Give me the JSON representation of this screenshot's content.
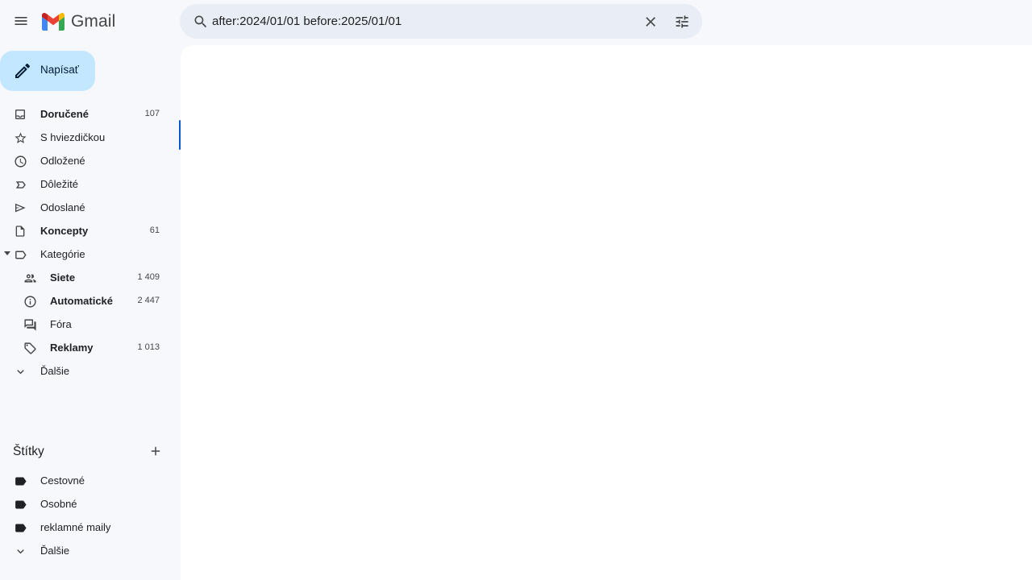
{
  "app": {
    "title": "Gmail"
  },
  "search": {
    "value": "after:2024/01/01 before:2025/01/01"
  },
  "compose": {
    "label": "Napísať"
  },
  "nav": {
    "items": [
      {
        "key": "inbox",
        "label": "Doručené",
        "count": "107",
        "bold": true,
        "icon": "inbox-icon"
      },
      {
        "key": "starred",
        "label": "S hviezdičkou",
        "count": "",
        "bold": false,
        "icon": "star-icon"
      },
      {
        "key": "snoozed",
        "label": "Odložené",
        "count": "",
        "bold": false,
        "icon": "clock-icon"
      },
      {
        "key": "important",
        "label": "Dôležité",
        "count": "",
        "bold": false,
        "icon": "important-icon"
      },
      {
        "key": "sent",
        "label": "Odoslané",
        "count": "",
        "bold": false,
        "icon": "send-icon"
      },
      {
        "key": "drafts",
        "label": "Koncepty",
        "count": "61",
        "bold": true,
        "icon": "draft-icon"
      },
      {
        "key": "categories",
        "label": "Kategórie",
        "count": "",
        "bold": false,
        "icon": "label-outline-icon"
      },
      {
        "key": "social",
        "label": "Siete",
        "count": "1 409",
        "bold": true,
        "icon": "people-icon"
      },
      {
        "key": "updates",
        "label": "Automatické",
        "count": "2 447",
        "bold": true,
        "icon": "info-icon"
      },
      {
        "key": "forums",
        "label": "Fóra",
        "count": "",
        "bold": false,
        "icon": "forum-icon"
      },
      {
        "key": "promotions",
        "label": "Reklamy",
        "count": "1 013",
        "bold": true,
        "icon": "tag-icon"
      },
      {
        "key": "more",
        "label": "Ďalšie",
        "count": "",
        "bold": false,
        "icon": "chevron-down-icon"
      }
    ]
  },
  "labels": {
    "title": "Štítky",
    "items": [
      {
        "label": "Cestovné",
        "icon": "label-filled-icon"
      },
      {
        "label": "Osobné",
        "icon": "label-filled-icon"
      },
      {
        "label": "reklamné maily",
        "icon": "label-filled-icon"
      },
      {
        "label": "Ďalšie",
        "icon": "chevron-down-icon"
      }
    ]
  },
  "colors": {
    "background": "#f6f8fc",
    "search_bg": "#e9eef6",
    "compose_bg": "#c2e7ff",
    "main_bg": "#ffffff",
    "accent": "#0b57d0"
  }
}
